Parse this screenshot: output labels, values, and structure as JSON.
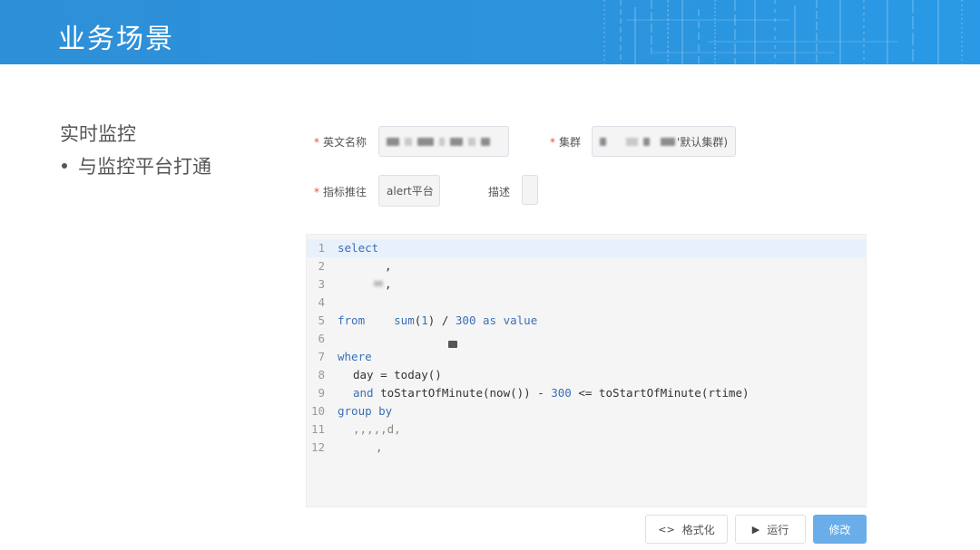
{
  "slide": {
    "title": "业务场景",
    "heading": "实时监控",
    "bullet": "与监控平台打通"
  },
  "form": {
    "required_mark": "*",
    "english_name_label": "英文名称",
    "cluster_label": "集群",
    "cluster_value_suffix": "'默认集群)",
    "metric_push_label": "指标推往",
    "metric_push_value": "alert平台",
    "description_label": "描述"
  },
  "editor": {
    "lines": [
      {
        "n": "1",
        "text": "select"
      },
      {
        "n": "2",
        "text": ","
      },
      {
        "n": "3",
        "text": ","
      },
      {
        "n": "4",
        "text": "sum(1) / 300 as value"
      },
      {
        "n": "5",
        "text": "from"
      },
      {
        "n": "6",
        "text": ""
      },
      {
        "n": "7",
        "text": "where"
      },
      {
        "n": "8",
        "text": "day = today()"
      },
      {
        "n": "9",
        "text": "and toStartOfMinute(now()) - 300 <= toStartOfMinute(rtime)"
      },
      {
        "n": "10",
        "text": "group by"
      },
      {
        "n": "11",
        "text": ",,,,,d,"
      },
      {
        "n": "12",
        "text": ","
      }
    ]
  },
  "buttons": {
    "format_label": "格式化",
    "format_icon": "code-brackets-icon",
    "run_label": "运行",
    "run_icon": "play-icon",
    "modify_label": "修改"
  },
  "colors": {
    "header_blue": "#2d8fd8",
    "primary_button": "#69aee9",
    "required_red": "#e8504a",
    "keyword_blue": "#3a6fb7"
  }
}
